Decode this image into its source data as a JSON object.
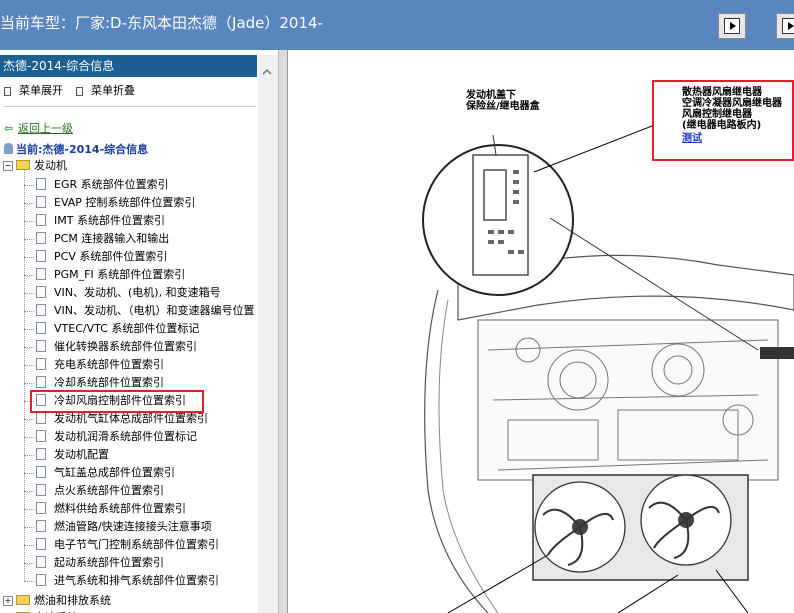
{
  "window": {
    "title": "当前车型：厂家:D-东风本田杰德（Jade）2014-"
  },
  "left_panel": {
    "header": "杰德-2014-综合信息",
    "expand_label": "菜单展开",
    "collapse_label": "菜单折叠",
    "back_label": "返回上一级",
    "current_label": "当前:杰德-2014-综合信息",
    "folder_engine": "发动机",
    "engine_items": [
      "EGR 系统部件位置索引",
      "EVAP 控制系统部件位置索引",
      "IMT 系统部件位置索引",
      "PCM 连接器输入和输出",
      "PCV 系统部件位置索引",
      "PGM_FI 系统部件位置索引",
      "VIN、发动机、(电机), 和变速箱号",
      "VIN、发动机、（电机）和变速器编号位置",
      "VTEC/VTC 系统部件位置标记",
      "催化转换器系统部件位置索引",
      "充电系统部件位置索引",
      "冷却系统部件位置索引",
      "冷却风扇控制部件位置索引",
      "发动机气缸体总成部件位置索引",
      "发动机润滑系统部件位置标记",
      "发动机配置",
      "气缸盖总成部件位置索引",
      "点火系统部件位置索引",
      "燃料供给系统部件位置索引",
      "燃油管路/快速连接接头注意事项",
      "电子节气门控制系统部件位置索引",
      "起动系统部件位置索引",
      "进气系统和排气系统部件位置索引"
    ],
    "folder_fuel": "燃油和排放系统",
    "folder_last": "变速系统"
  },
  "diagram": {
    "label_fusebox": "发动机盖下\n保险丝/继电器盒",
    "callout_lines": [
      "散热器风扇继电器",
      "空调冷凝器风扇继电器",
      "风扇控制继电器",
      "(继电器电路板内)"
    ],
    "test_link": "测试"
  },
  "colors": {
    "titlebar": "#5a86bf",
    "header": "#1b5f93",
    "highlight": "#e0202a"
  }
}
